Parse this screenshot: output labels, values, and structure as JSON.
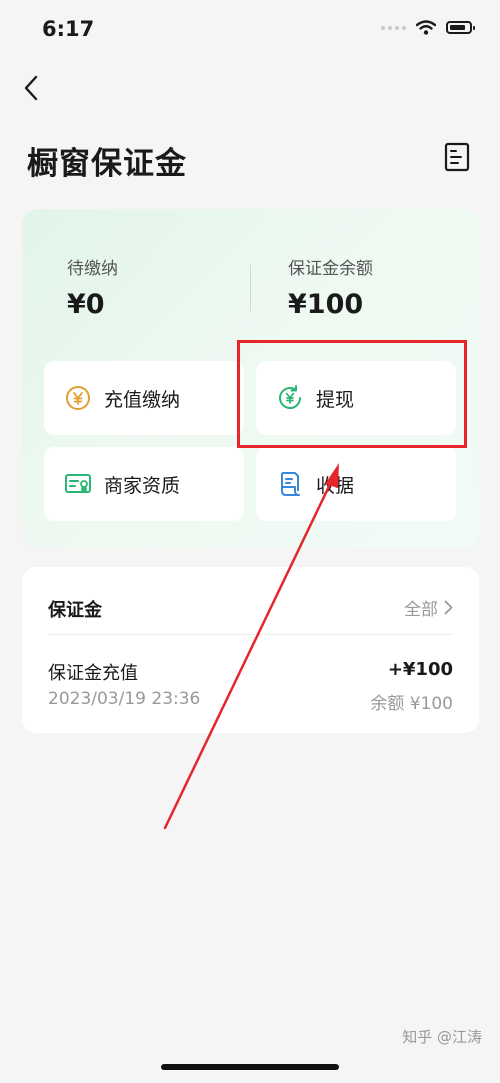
{
  "status_bar": {
    "time": "6:17"
  },
  "header": {
    "title": "橱窗保证金"
  },
  "deposit": {
    "pending_label": "待缴纳",
    "pending_value": "¥0",
    "balance_label": "保证金余额",
    "balance_value": "¥100",
    "actions": {
      "recharge": "充值缴纳",
      "withdraw": "提现",
      "qualification": "商家资质",
      "receipt": "收据"
    }
  },
  "records": {
    "title": "保证金",
    "all_label": "全部",
    "items": [
      {
        "name": "保证金充值",
        "date": "2023/03/19 23:36",
        "amount": "+¥100",
        "balance": "余额 ¥100"
      }
    ]
  },
  "watermark": "知乎 @江涛",
  "colors": {
    "accent_green": "#2bb673",
    "highlight_red": "#e6262b",
    "coin_orange": "#e0a030"
  }
}
